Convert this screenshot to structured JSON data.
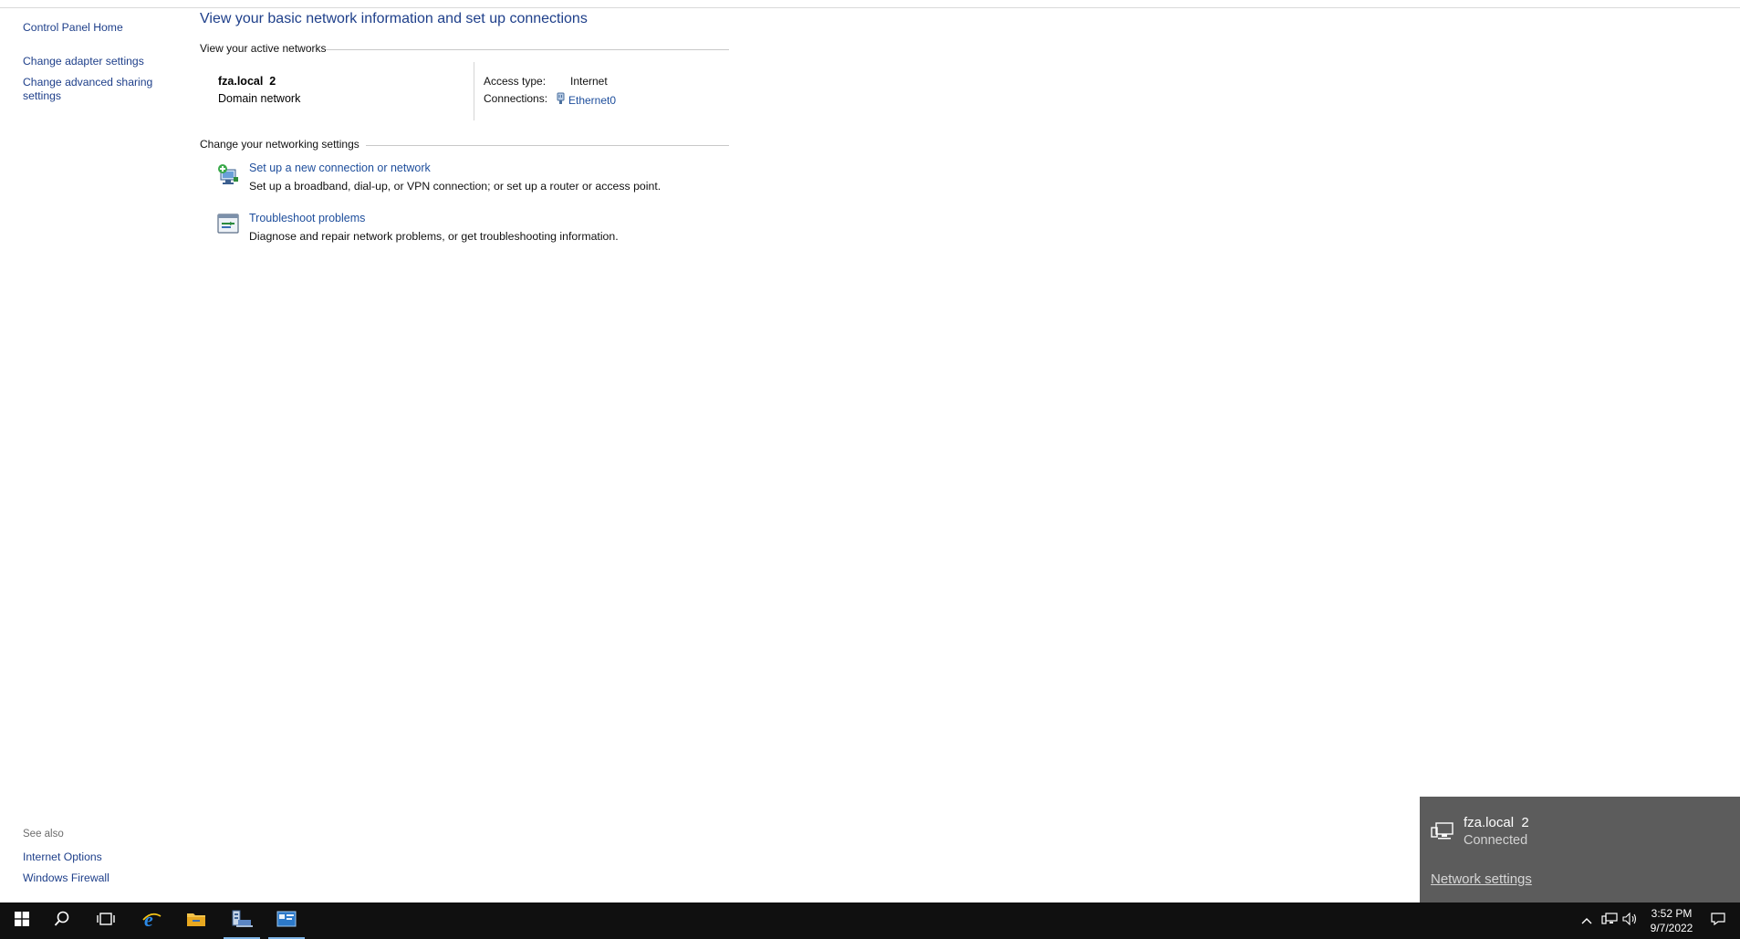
{
  "left_pane": {
    "home": "Control Panel Home",
    "adapter_settings": "Change adapter settings",
    "advanced_sharing": "Change advanced sharing settings",
    "see_also_label": "See also",
    "see_also": [
      "Internet Options",
      "Windows Firewall"
    ]
  },
  "main": {
    "title": "View your basic network information and set up connections",
    "active_networks_heading": "View your active networks",
    "network": {
      "name": "fza.local  2",
      "type": "Domain network",
      "access_type_label": "Access type:",
      "access_type_value": "Internet",
      "connections_label": "Connections:",
      "connections_value": "Ethernet0"
    },
    "change_settings_heading": "Change your networking settings",
    "tasks": [
      {
        "link": "Set up a new connection or network",
        "description": "Set up a broadband, dial-up, or VPN connection; or set up a router or access point.",
        "icon": "new-connection-icon"
      },
      {
        "link": "Troubleshoot problems",
        "description": "Diagnose and repair network problems, or get troubleshooting information.",
        "icon": "troubleshoot-icon"
      }
    ]
  },
  "flyout": {
    "network_name": "fza.local  2",
    "status": "Connected",
    "settings_link": "Network settings"
  },
  "taskbar": {
    "apps": [
      "start-icon",
      "search-icon",
      "task-view-icon",
      "internet-explorer-icon",
      "file-explorer-icon",
      "server-manager-icon",
      "control-panel-icon"
    ],
    "clock_time": "3:52 PM",
    "clock_date": "9/7/2022"
  },
  "colors": {
    "link": "#1e4e9c",
    "flyout_bg": "#5c5c5c",
    "taskbar_bg": "#101010"
  }
}
